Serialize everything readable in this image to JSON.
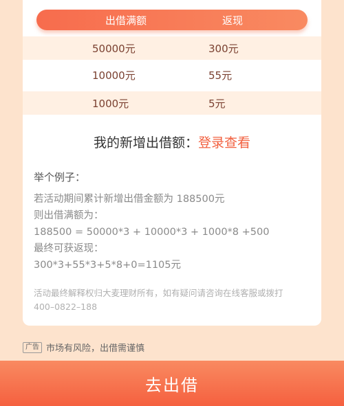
{
  "table": {
    "headers": [
      "出借满额",
      "返现"
    ],
    "rows": [
      [
        "50000元",
        "300元"
      ],
      [
        "10000元",
        "55元"
      ],
      [
        "1000元",
        "5元"
      ]
    ]
  },
  "my_amount": {
    "label": "我的新增出借额：",
    "link": "登录查看"
  },
  "example": {
    "title": "举个例子：",
    "lines": [
      "若活动期间累计新增出借金额为 188500元",
      "则出借满额为：",
      "188500 = 50000*3 + 10000*3 + 1000*8 +500",
      "最终可获返现：",
      "300*3+55*3+5*8+0=1105元"
    ]
  },
  "disclaimer": {
    "line1": "活动最终解释权归大麦理财所有，如有疑问请咨询在线客服或拨打",
    "line2": "400–0822–188"
  },
  "ad": {
    "badge": "广告",
    "text": "市场有风险，出借需谨慎"
  },
  "cta": {
    "label": "去出借"
  }
}
